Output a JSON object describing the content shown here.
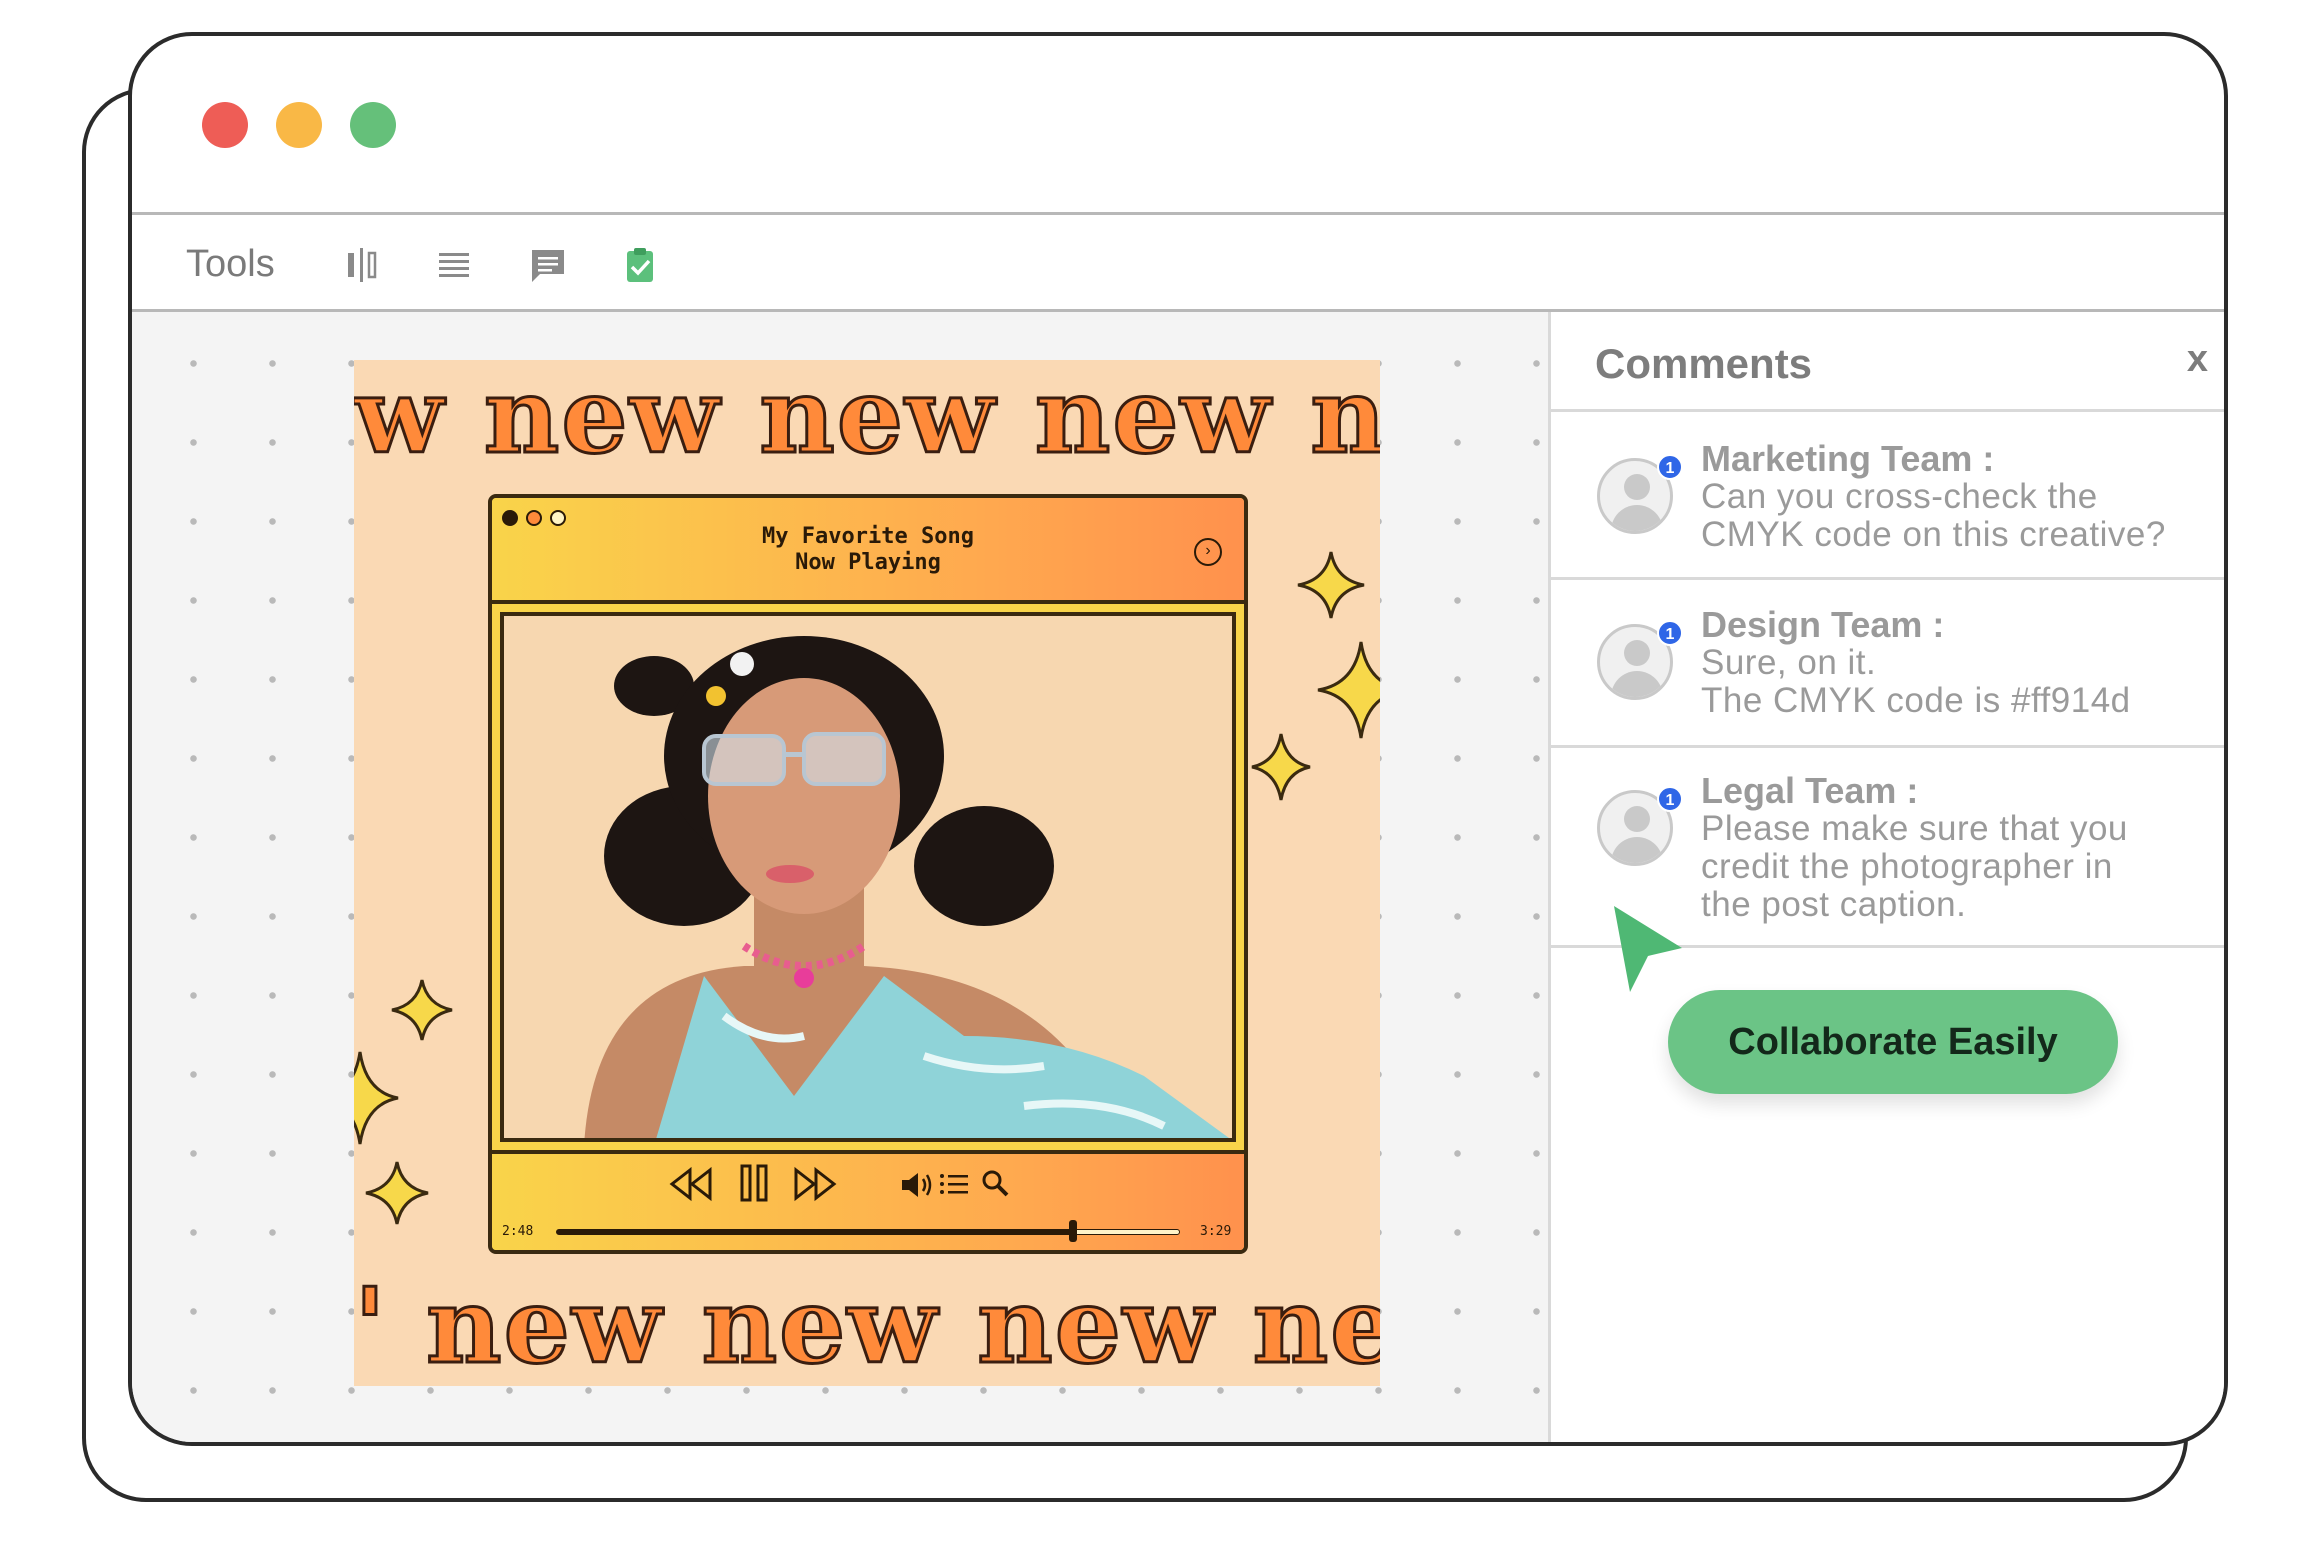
{
  "window": {
    "traffic_lights": [
      "close",
      "minimize",
      "maximize"
    ]
  },
  "toolbar": {
    "tools_label": "Tools",
    "icons": [
      "align-icon",
      "text-lines-icon",
      "comment-icon",
      "task-check-icon"
    ]
  },
  "poster": {
    "repeat_text_top": "w new new new ne",
    "repeat_text_bottom": "' new new new new",
    "player": {
      "title_line1": "My Favorite Song",
      "title_line2": "Now Playing",
      "time_elapsed": "2:48",
      "time_total": "3:29",
      "progress": 0.83
    },
    "colors": {
      "background": "#fad9b4",
      "accent_orange": "#ff8a3a",
      "accent_yellow": "#f9d44a"
    }
  },
  "comments": {
    "title": "Comments",
    "close_label": "x",
    "items": [
      {
        "author": "Marketing Team :",
        "lines": [
          "Can you cross-check the",
          "CMYK code on this creative?"
        ],
        "badge": "1"
      },
      {
        "author": "Design Team :",
        "lines": [
          "Sure, on it.",
          "The CMYK code is #ff914d"
        ],
        "badge": "1"
      },
      {
        "author": "Legal Team :",
        "lines": [
          "Please make sure that you",
          "credit the photographer in",
          "the post caption."
        ],
        "badge": "1"
      }
    ]
  },
  "cta": {
    "label": "Collaborate Easily",
    "color": "#6bc486"
  }
}
